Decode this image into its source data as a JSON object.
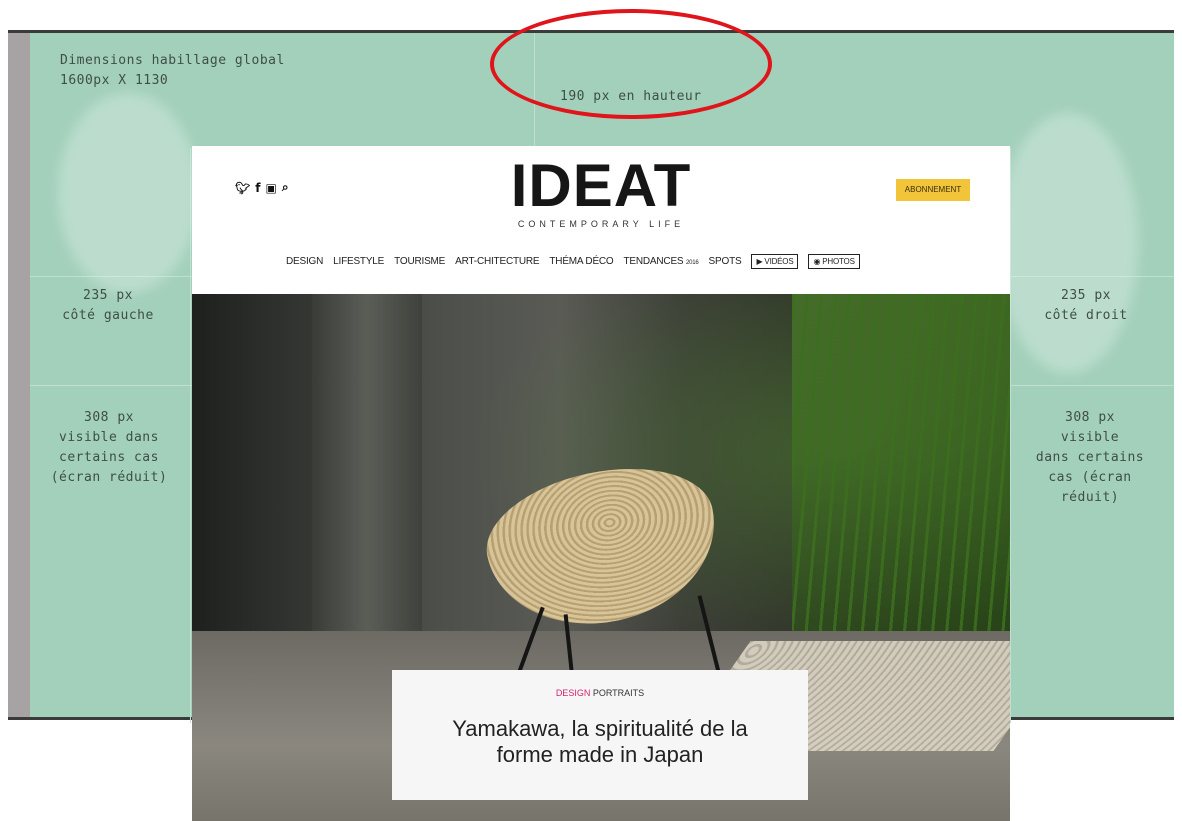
{
  "takeover": {
    "dimensions_line1": "Dimensions habillage global",
    "dimensions_line2": "1600px X 1130",
    "top_height": "190 px en hauteur",
    "left_235": "235 px",
    "left_235_sub": "côté gauche",
    "right_235": "235 px",
    "right_235_sub": "côté droit",
    "left_308": [
      "308 px",
      "visible dans",
      "certains cas",
      "(écran réduit)"
    ],
    "right_308": [
      "308 px",
      "visible",
      "dans certains",
      "cas (écran",
      "réduit)"
    ]
  },
  "site": {
    "social_icons": [
      "twitter-icon",
      "facebook-icon",
      "instagram-icon",
      "search-icon"
    ],
    "logo": "IDEAT",
    "tagline": "CONTEMPORARY LIFE",
    "subscribe": "ABONNEMENT",
    "nav": {
      "design": "DESIGN",
      "lifestyle": "LIFESTYLE",
      "tourisme": "TOURISME",
      "archi": "ART-CHITECTURE",
      "thema": "THÉMA DÉCO",
      "tendances": "TENDANCES",
      "tendances_year": "2016",
      "spots": "SPOTS",
      "videos": "▶ VIDÉOS",
      "photos": "◉ PHOTOS"
    },
    "hero": {
      "category_pink": "DESIGN",
      "category_rest": " PORTRAITS",
      "title": "Yamakawa, la spiritualité de la forme made in Japan"
    }
  },
  "colors": {
    "mint": "#a3d0bb",
    "ellipse": "#e0141b",
    "subscribe": "#f2c43a",
    "category_pink": "#d2246e"
  }
}
